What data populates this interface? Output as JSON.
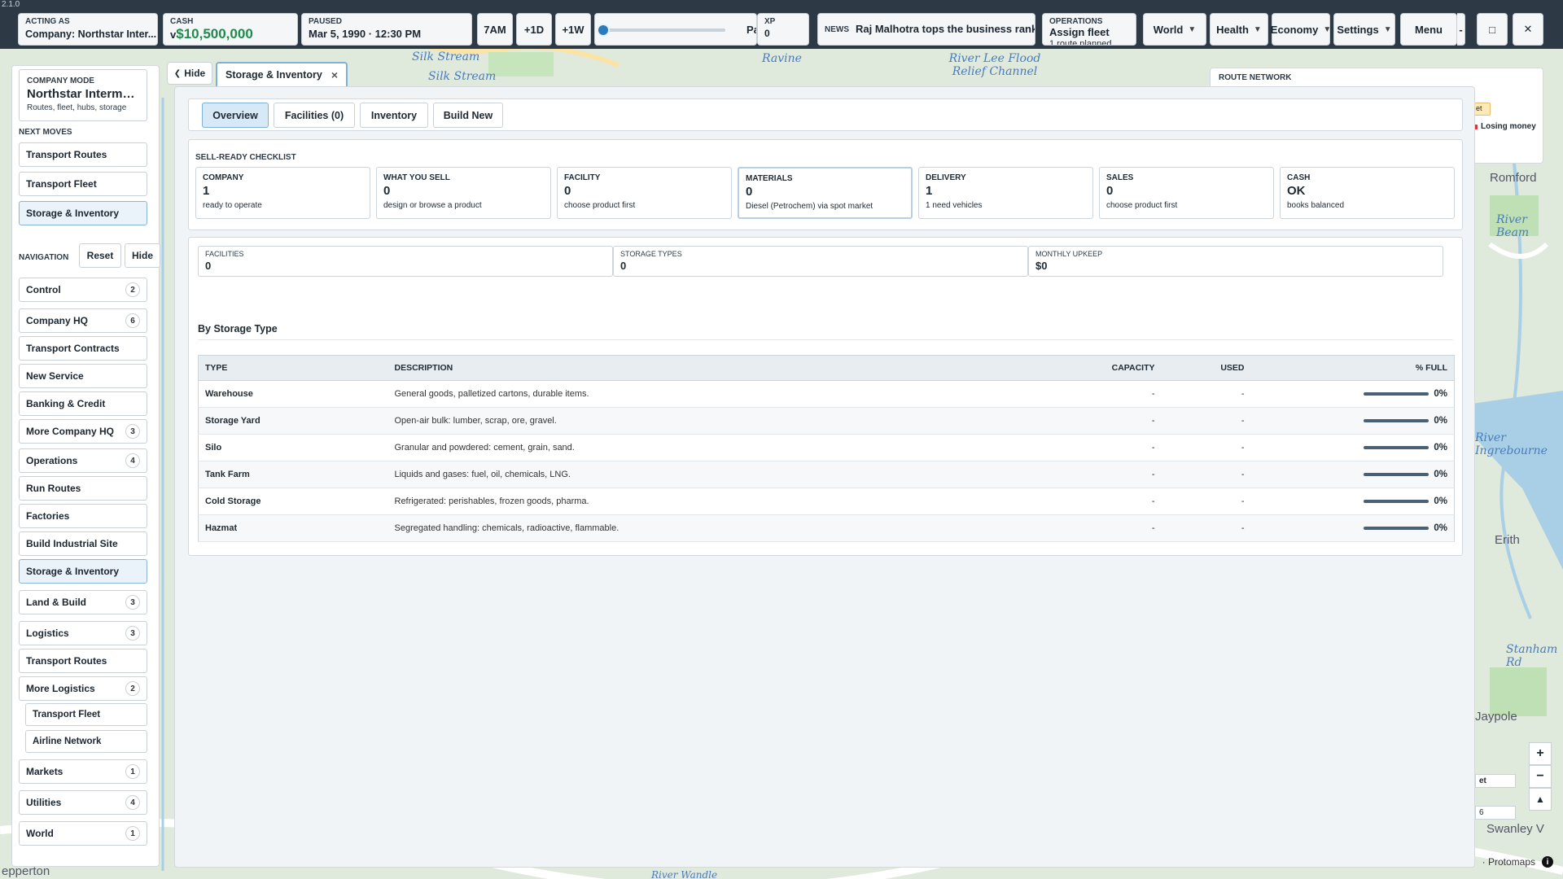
{
  "version": "2.1.0",
  "topbar": {
    "acting_as_caption": "ACTING AS",
    "acting_as_value": "Company: Northstar Inter...",
    "cash_caption": "CASH",
    "cash_prefix": "v",
    "cash_value": "$10,500,000",
    "paused_caption": "PAUSED",
    "paused_value": "Mar 5, 1990 · 12:30 PM",
    "btn_7am": "7AM",
    "btn_1d": "+1D",
    "btn_1w": "+1W",
    "speed_slider_level": 0,
    "speed_label": "Pa",
    "xp_caption": "XP",
    "xp_value": "0",
    "news_caption": "NEWS",
    "news_value": "Raj Malhotra tops the business rank",
    "operations_caption": "OPERATIONS",
    "operations_value": "Assign fleet",
    "operations_sub": "1 route planned",
    "menus": [
      "World",
      "Health",
      "Economy",
      "Settings"
    ],
    "menu_button": "Menu",
    "min_icon": "-",
    "max_icon": "□",
    "close_icon": "✕"
  },
  "sidebar": {
    "mode_caption": "COMPANY MODE",
    "mode_name": "Northstar Intermo...",
    "mode_sub": "Routes, fleet, hubs, storage",
    "next_moves_caption": "NEXT MOVES",
    "next_moves": [
      "Transport Routes",
      "Transport Fleet",
      "Storage & Inventory"
    ],
    "navigation_caption": "NAVIGATION",
    "reset_label": "Reset",
    "hide_label": "Hide",
    "items": [
      {
        "label": "Control",
        "badge": "2"
      },
      {
        "label": "Company HQ",
        "badge": "6"
      },
      {
        "label": "Transport Contracts",
        "badge": ""
      },
      {
        "label": "New Service",
        "badge": ""
      },
      {
        "label": "Banking & Credit",
        "badge": ""
      },
      {
        "label": "More Company HQ",
        "badge": "3"
      },
      {
        "label": "Operations",
        "badge": "4"
      },
      {
        "label": "Run Routes",
        "badge": ""
      },
      {
        "label": "Factories",
        "badge": ""
      },
      {
        "label": "Build Industrial Site",
        "badge": ""
      },
      {
        "label": "Storage & Inventory",
        "badge": ""
      },
      {
        "label": "Land & Build",
        "badge": "3"
      },
      {
        "label": "Logistics",
        "badge": "3"
      },
      {
        "label": "Transport Routes",
        "badge": ""
      },
      {
        "label": "More Logistics",
        "badge": "2"
      },
      {
        "label": "Transport Fleet",
        "badge": ""
      },
      {
        "label": "Airline Network",
        "badge": ""
      },
      {
        "label": "Markets",
        "badge": "1"
      },
      {
        "label": "Utilities",
        "badge": "4"
      },
      {
        "label": "World",
        "badge": "1"
      }
    ]
  },
  "window": {
    "hide_label": "Hide",
    "tab_title": "Storage & Inventory",
    "tab_close": "×",
    "subtabs": [
      "Overview",
      "Facilities (0)",
      "Inventory",
      "Build New"
    ],
    "checklist_caption": "SELL-READY CHECKLIST",
    "checklist": [
      {
        "title": "COMPANY",
        "value": "1",
        "sub": "ready to operate"
      },
      {
        "title": "WHAT YOU SELL",
        "value": "0",
        "sub": "design or browse a product"
      },
      {
        "title": "FACILITY",
        "value": "0",
        "sub": "choose product first"
      },
      {
        "title": "MATERIALS",
        "value": "0",
        "sub": "Diesel (Petrochem) via spot market"
      },
      {
        "title": "DELIVERY",
        "value": "1",
        "sub": "1 need vehicles"
      },
      {
        "title": "SALES",
        "value": "0",
        "sub": "choose product first"
      },
      {
        "title": "CASH",
        "value": "OK",
        "sub": "books balanced"
      }
    ],
    "stats": [
      {
        "title": "FACILITIES",
        "value": "0"
      },
      {
        "title": "STORAGE TYPES",
        "value": "0"
      },
      {
        "title": "MONTHLY UPKEEP",
        "value": "$0"
      }
    ],
    "section_title": "By Storage Type",
    "table_headers": {
      "type": "TYPE",
      "description": "DESCRIPTION",
      "capacity": "CAPACITY",
      "used": "USED",
      "full": "% FULL"
    },
    "rows": [
      {
        "type": "Warehouse",
        "description": "General goods, palletized cartons, durable items.",
        "capacity": "-",
        "used": "-",
        "full": "0%",
        "fill": 0
      },
      {
        "type": "Storage Yard",
        "description": "Open-air bulk: lumber, scrap, ore, gravel.",
        "capacity": "-",
        "used": "-",
        "full": "0%",
        "fill": 0
      },
      {
        "type": "Silo",
        "description": "Granular and powdered: cement, grain, sand.",
        "capacity": "-",
        "used": "-",
        "full": "0%",
        "fill": 0
      },
      {
        "type": "Tank Farm",
        "description": "Liquids and gases: fuel, oil, chemicals, LNG.",
        "capacity": "-",
        "used": "-",
        "full": "0%",
        "fill": 0
      },
      {
        "type": "Cold Storage",
        "description": "Refrigerated: perishables, frozen goods, pharma.",
        "capacity": "-",
        "used": "-",
        "full": "0%",
        "fill": 0
      },
      {
        "type": "Hazmat",
        "description": "Segregated handling: chemicals, radioactive, flammable.",
        "capacity": "-",
        "used": "-",
        "full": "0%",
        "fill": 0
      }
    ]
  },
  "route_network": {
    "caption": "ROUTE NETWORK",
    "chip": "et",
    "status": "Losing money"
  },
  "map": {
    "labels": [
      "Silk Stream",
      "Silk Stream",
      "Ravine",
      "River Lee Flood Relief Channel",
      "Romford",
      "River Beam",
      "River Ingrebourne",
      "Erith",
      "Stanham Rd",
      "Jaypole",
      "Swanley V",
      "epperton",
      "River Wandle"
    ],
    "zoom_in": "+",
    "zoom_out": "−",
    "compass": "▲",
    "widget_a": "et",
    "widget_b": "6",
    "attribution": "· Protomaps",
    "info": "i"
  }
}
